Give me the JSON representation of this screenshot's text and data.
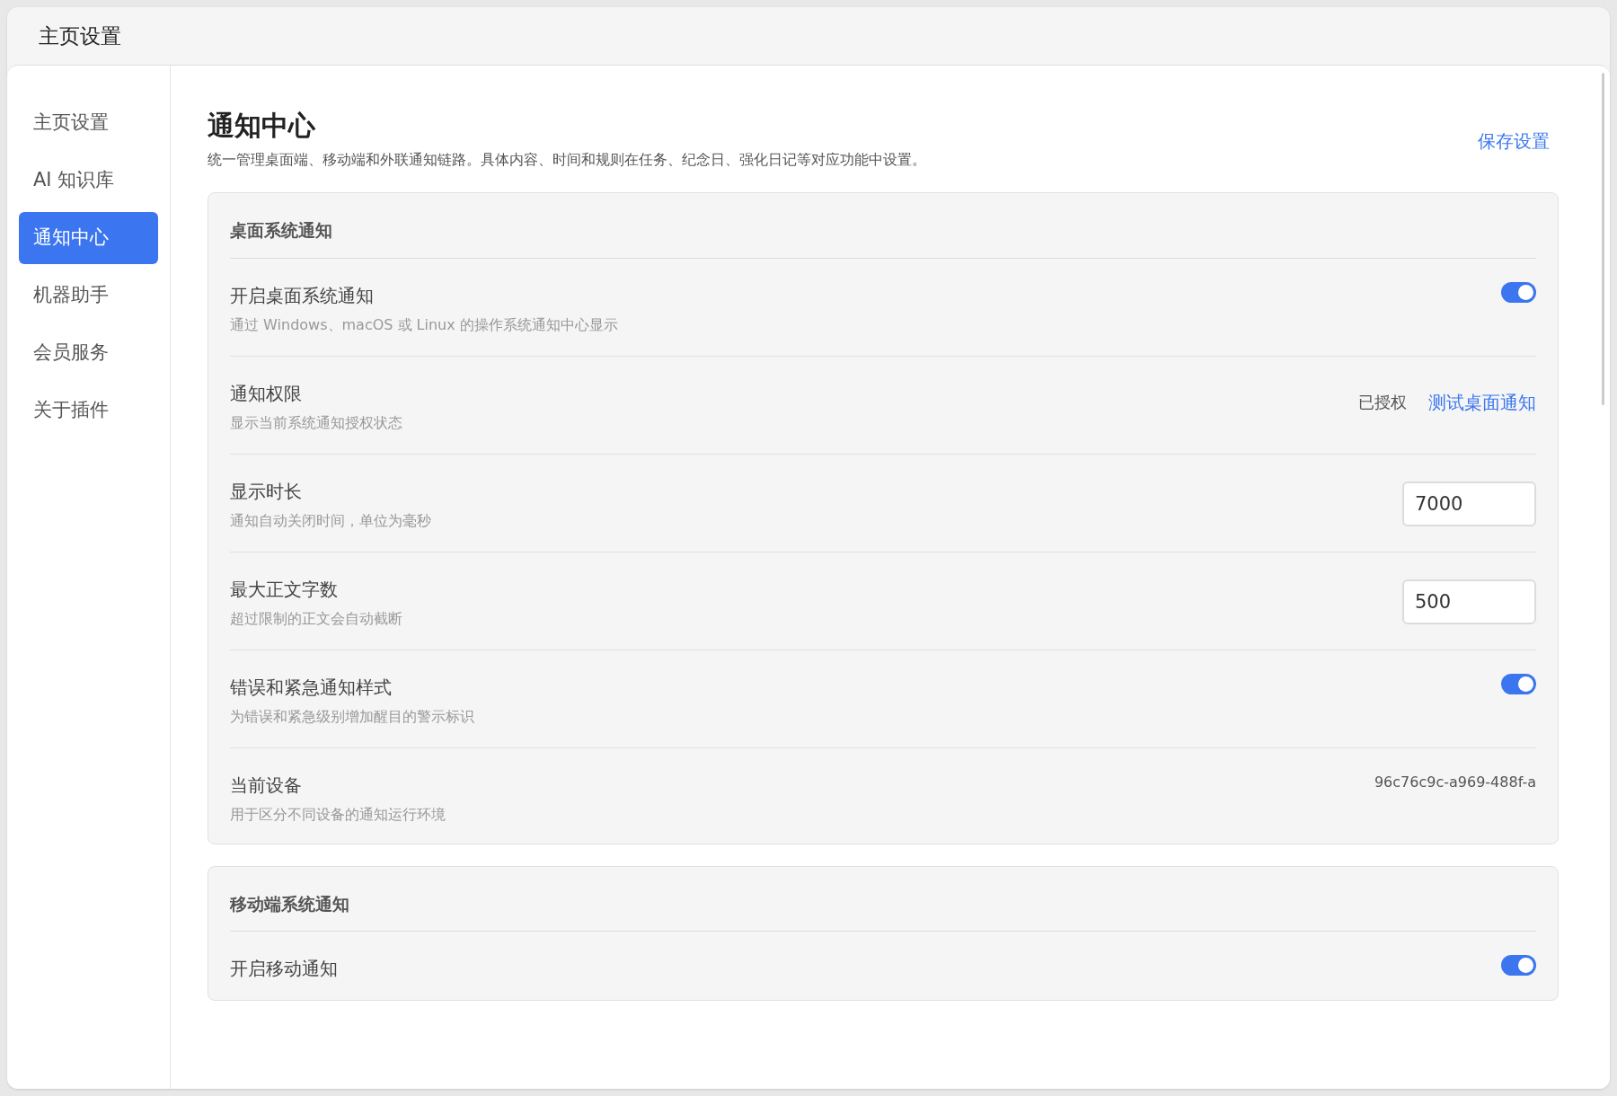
{
  "window": {
    "title": "主页设置"
  },
  "sidebar": {
    "items": [
      {
        "label": "主页设置",
        "selected": false
      },
      {
        "label": "AI 知识库",
        "selected": false
      },
      {
        "label": "通知中心",
        "selected": true
      },
      {
        "label": "机器助手",
        "selected": false
      },
      {
        "label": "会员服务",
        "selected": false
      },
      {
        "label": "关于插件",
        "selected": false
      }
    ]
  },
  "page": {
    "title": "通知中心",
    "subtitle": "统一管理桌面端、移动端和外联通知链路。具体内容、时间和规则在任务、纪念日、强化日记等对应功能中设置。",
    "save_link": "保存设置"
  },
  "sections": [
    {
      "title": "桌面系统通知",
      "rows": [
        {
          "kind": "toggle",
          "title": "开启桌面系统通知",
          "description": "通过 Windows、macOS 或 Linux 的操作系统通知中心显示",
          "on": true
        },
        {
          "kind": "status",
          "title": "通知权限",
          "description": "显示当前系统通知授权状态",
          "status": "已授权",
          "action": "测试桌面通知"
        },
        {
          "kind": "input",
          "title": "显示时长",
          "description": "通知自动关闭时间，单位为毫秒",
          "value": "7000"
        },
        {
          "kind": "input",
          "title": "最大正文字数",
          "description": "超过限制的正文会自动截断",
          "value": "500"
        },
        {
          "kind": "toggle",
          "title": "错误和紧急通知样式",
          "description": "为错误和紧急级别增加醒目的警示标识",
          "on": true
        },
        {
          "kind": "text",
          "title": "当前设备",
          "description": "用于区分不同设备的通知运行环境",
          "value": "96c76c9c-a969-488f-a"
        }
      ]
    },
    {
      "title": "移动端系统通知",
      "rows": [
        {
          "kind": "toggle",
          "title": "开启移动通知",
          "on": true
        }
      ]
    }
  ]
}
